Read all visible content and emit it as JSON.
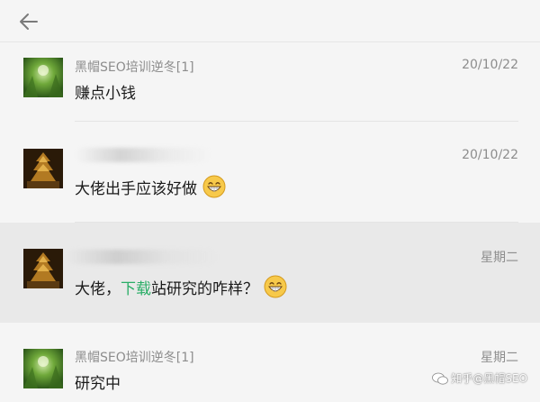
{
  "header": {
    "back_icon": "arrow-left-icon"
  },
  "messages": [
    {
      "sender": "黑帽SEO培训逆冬[1]",
      "time": "20/10/22",
      "text": "赚点小钱"
    },
    {
      "sender": "",
      "time": "20/10/22",
      "text": "大佬出手应该好做"
    },
    {
      "sender": "",
      "time": "星期二",
      "text_before": "大佬，",
      "text_link": "下载",
      "text_after": "站研究的咋样？"
    },
    {
      "sender": "黑帽SEO培训逆冬[1]",
      "time": "星期二",
      "text": "研究中"
    }
  ],
  "watermark": {
    "text": "知乎@黑帽SEO"
  },
  "colors": {
    "background": "#f5f5f5",
    "highlight_row": "#e9e9e9",
    "link": "#2aae67"
  }
}
